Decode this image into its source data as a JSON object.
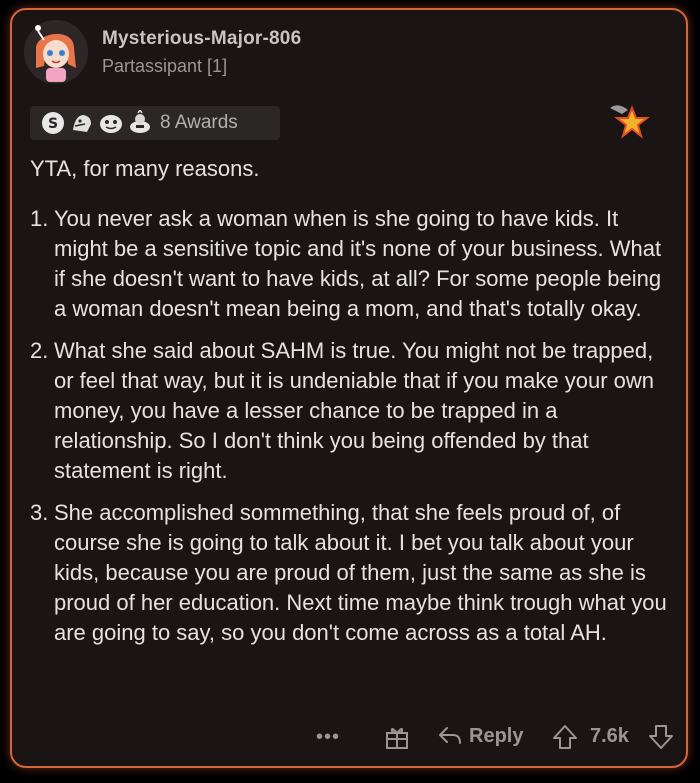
{
  "comment": {
    "username": "Mysterious-Major-806",
    "flair": "Partassipant [1]",
    "awards_label": "8 Awards",
    "award_icons": [
      "silver-award-icon",
      "wholesome-award-icon",
      "helpful-award-icon",
      "rocket-like-award-icon"
    ],
    "intro": "YTA, for many reasons.",
    "points": [
      {
        "number": "1.",
        "text": "You never ask a woman when is she going to have kids. It might be a sensitive topic and it's none of your business. What if she doesn't want to have kids, at all? For some people being a woman doesn't mean being a mom, and that's totally okay."
      },
      {
        "number": "2.",
        "text": "What she said about SAHM is true. You might not be trapped, or feel that way, but it is undeniable that if you make your own money, you have a lesser chance to be trapped in a relationship. So I don't think you being offended by that statement is right."
      },
      {
        "number": "3.",
        "text": "She accomplished sommething, that she feels proud of, of course she is going to talk about it. I bet you talk about your kids, because you are proud of them, just the same as she is proud of her education. Next time maybe think trough what you are going to say, so you don't come across as a total AH."
      }
    ]
  },
  "footer": {
    "more": "•••",
    "reply_label": "Reply",
    "score": "7.6k"
  },
  "colors": {
    "card_border": "#d9653a",
    "card_background": "#1a1414",
    "text": "#e6e2e2",
    "muted": "#9b9696"
  }
}
